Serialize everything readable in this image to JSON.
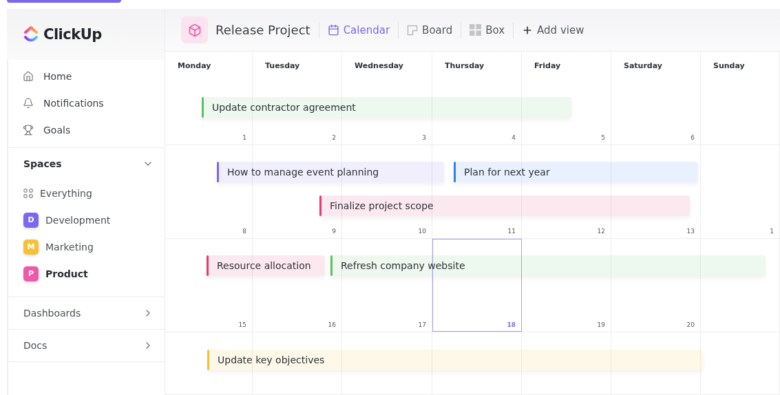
{
  "sidebar": {
    "logo": "ClickUp",
    "nav": [
      {
        "label": "Home"
      },
      {
        "label": "Notifications"
      },
      {
        "label": "Goals"
      }
    ],
    "spaces": {
      "title": "Spaces",
      "expanded": true,
      "items": [
        {
          "kind": "all",
          "label": "Everything",
          "selected": false
        },
        {
          "kind": "space",
          "letter": "D",
          "label": "Development",
          "color": "#7b68ee",
          "selected": false
        },
        {
          "kind": "space",
          "letter": "M",
          "label": "Marketing",
          "color": "#f7c137",
          "selected": false
        },
        {
          "kind": "space",
          "letter": "P",
          "label": "Product",
          "color": "#ec5aa8",
          "selected": true
        }
      ]
    },
    "sections": [
      {
        "label": "Dashboards",
        "expanded": false
      },
      {
        "label": "Docs",
        "expanded": false
      }
    ]
  },
  "header": {
    "title": "Release Project",
    "views": [
      {
        "label": "Calendar",
        "selected": true
      },
      {
        "label": "Board",
        "selected": false
      },
      {
        "label": "Box",
        "selected": false
      }
    ],
    "add_view": "Add view"
  },
  "calendar": {
    "days": [
      "Monday",
      "Tuesday",
      "Wednesday",
      "Thursday",
      "Friday",
      "Saturday",
      "Sunday"
    ],
    "weeks": [
      {
        "cells": [
          {
            "date": "1",
            "today": false
          },
          {
            "date": "2",
            "today": false
          },
          {
            "date": "3",
            "today": false
          },
          {
            "date": "4",
            "today": false
          },
          {
            "date": "5",
            "today": false
          },
          {
            "date": "6",
            "today": false
          },
          {
            "today": false
          }
        ],
        "events": [
          {
            "title": "Update contractor agreement",
            "color": "#5cc163"
          }
        ]
      },
      {
        "cells": [
          {
            "date": "8",
            "today": false
          },
          {
            "date": "9",
            "today": false
          },
          {
            "date": "10",
            "today": false
          },
          {
            "date": "11",
            "today": false
          },
          {
            "date": "12",
            "today": false
          },
          {
            "date": "13",
            "today": false
          },
          {
            "date": "1",
            "today": false
          }
        ],
        "events": [
          {
            "title": "How to manage event planning",
            "color": "#7b68ee"
          },
          {
            "title": "Plan for next year",
            "color": "#2f7fec"
          },
          {
            "title": "Finalize project scope",
            "color": "#e8386d"
          }
        ]
      },
      {
        "cells": [
          {
            "date": "15",
            "today": false
          },
          {
            "date": "16",
            "today": false
          },
          {
            "date": "17",
            "today": false
          },
          {
            "date": "18",
            "today": true
          },
          {
            "date": "19",
            "today": false
          },
          {
            "date": "20",
            "today": false
          },
          {
            "today": false
          }
        ],
        "events": [
          {
            "title": "Resource allocation",
            "color": "#e8386d"
          },
          {
            "title": "Refresh company website",
            "color": "#5cc163"
          }
        ]
      },
      {
        "events": [
          {
            "title": "Update key objectives",
            "color": "#f7c137"
          }
        ]
      }
    ]
  }
}
